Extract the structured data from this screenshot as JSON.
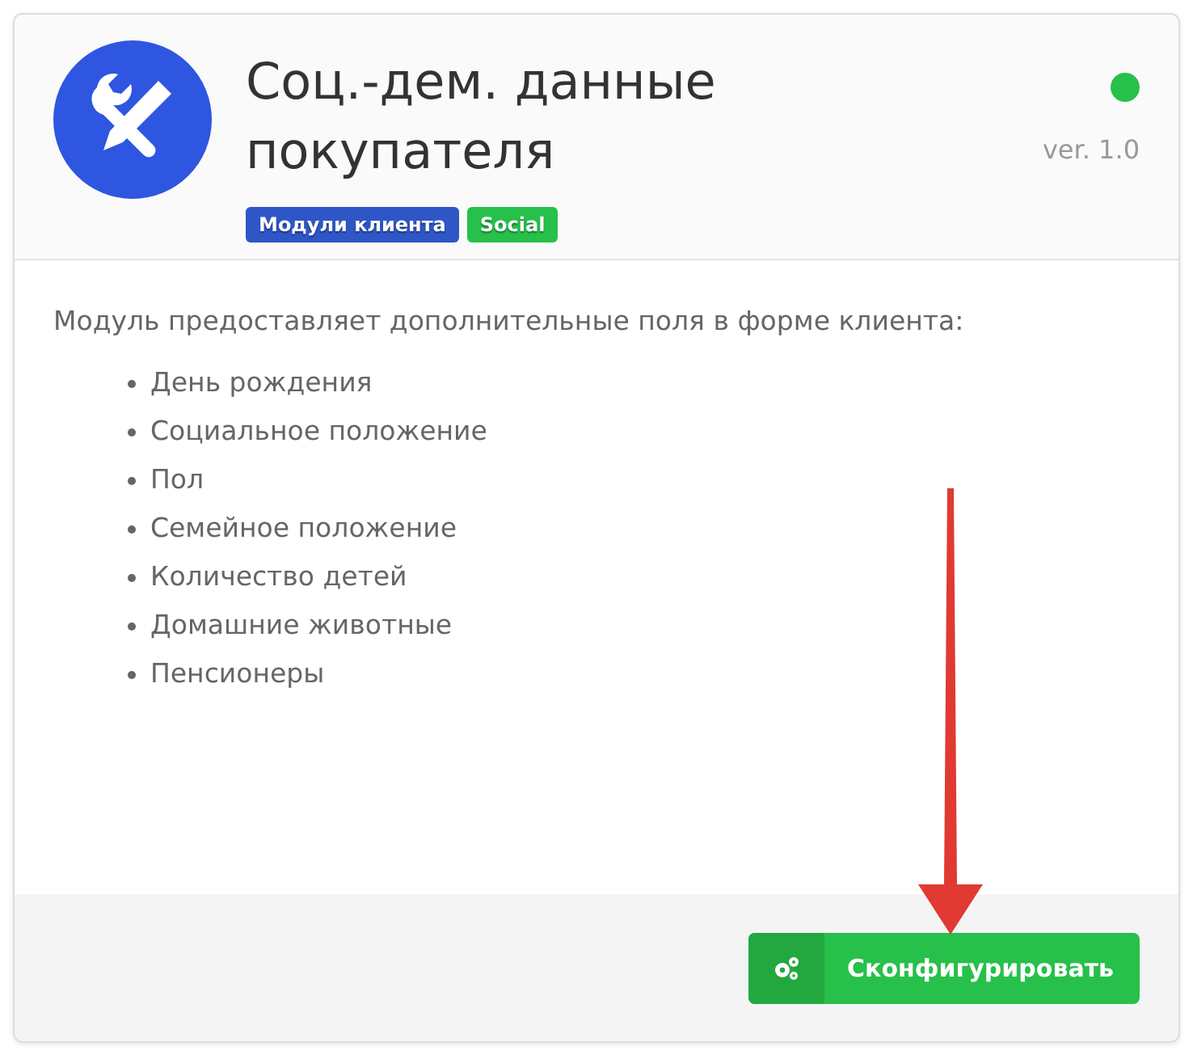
{
  "module": {
    "title": "Соц.-дем. данные покупателя",
    "enabled": true,
    "version": "ver. 1.0",
    "tags": [
      {
        "label": "Модули клиента",
        "color": "#2e56c6"
      },
      {
        "label": "Social",
        "color": "#27c04a"
      }
    ]
  },
  "description": "Модуль предоставляет дополнительные поля в форме клиента:",
  "fields": [
    "День рождения",
    "Социальное положение",
    "Пол",
    "Семейное положение",
    "Количество детей",
    "Домашние животные",
    "Пенсионеры"
  ],
  "configure_button": {
    "label": "Сконфигурировать"
  }
}
